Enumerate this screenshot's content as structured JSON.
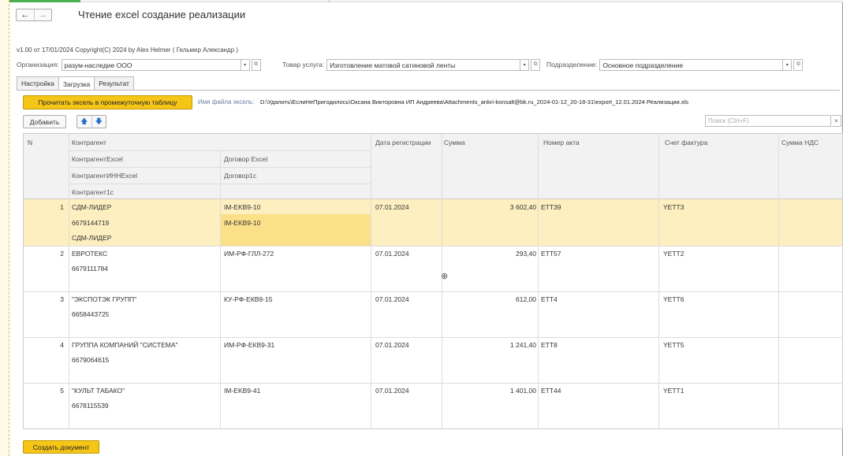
{
  "window": {
    "title": "Чтение excel создание реализации",
    "back": "←",
    "forward": "→"
  },
  "version_line": "v1.00 от 17/01/2024  Copyright(C) 2024 by Alex Helmer ( Гельмер Александр )",
  "fields": {
    "org_label": "Организация:",
    "org_value": "разум-наследие ООО",
    "goods_label": "Товар услуга:",
    "goods_value": "Изготовление матовой сатиновой ленты",
    "dept_label": "Подразделение:",
    "dept_value": "Основное подразделение"
  },
  "tabs": [
    {
      "label": "Настройка"
    },
    {
      "label": "Загрузка"
    },
    {
      "label": "Результат"
    }
  ],
  "toolbar": {
    "read_button": "Прочитать эксель в промежуточную таблицу",
    "filename_label": "Имя файла эксель:",
    "filename_value": "D:\\Удалить\\ЕслиНеПригодилось\\Оксана Викторовна ИП Андреева\\Attachments_ankri-konsalt@bk.ru_2024-01-12_20-18-31\\export_12.01.2024 Реализации.xls",
    "add_button": "Добавить",
    "search_placeholder": "Поиск (Ctrl+F)",
    "search_clear": "×"
  },
  "table": {
    "headers": {
      "n": "N",
      "kontragent": "Контрагент",
      "kontragent_excel": "КонтрагентExcel",
      "dogovor_excel": "Договор Excel",
      "kontragent_inn": "КонтрагентИННExcel",
      "dogovor1c": "Договор1с",
      "kontragent1c": "Контрагент1с",
      "date": "Дата регистрации",
      "sum": "Сумма",
      "act": "Номер акта",
      "invoice": "Счет фактура",
      "vat": "Сумма НДС"
    },
    "rows": [
      {
        "n": "1",
        "name": "СДМ-ЛИДЕР",
        "inn": "6679144719",
        "k1c": "СДМ-ЛИДЕР",
        "contract": "IM-EKB9-10",
        "contract1c": "IM-EKB9-10",
        "date": "07.01.2024",
        "sum": "3 602,40",
        "act": "ETT39",
        "invoice": "YETT3"
      },
      {
        "n": "2",
        "name": "ЕВРОТЕКС",
        "inn": "6679111784",
        "k1c": "",
        "contract": "ИМ-РФ-ГЛЛ-272",
        "contract1c": "",
        "date": "07.01.2024",
        "sum": "293,40",
        "act": "ETT57",
        "invoice": "YETT2"
      },
      {
        "n": "3",
        "name": "\"ЭКСПОТЭК ГРУПП\"",
        "inn": "6658443725",
        "k1c": "",
        "contract": "КУ-РФ-ЕКВ9-15",
        "contract1c": "",
        "date": "07.01.2024",
        "sum": "612,00",
        "act": "ETT4",
        "invoice": "YETT6"
      },
      {
        "n": "4",
        "name": "ГРУППА КОМПАНИЙ \"СИСТЕМА\"",
        "inn": "6679064615",
        "k1c": "",
        "contract": "ИМ-РФ-ЕКВ9-31",
        "contract1c": "",
        "date": "07.01.2024",
        "sum": "1 241,40",
        "act": "ETT8",
        "invoice": "YETT5"
      },
      {
        "n": "5",
        "name": "\"КУЛЬТ ТАБАКО\"",
        "inn": "6678115539",
        "k1c": "",
        "contract": "IM-EKB9-41",
        "contract1c": "",
        "date": "07.01.2024",
        "sum": "1 401,00",
        "act": "ETT44",
        "invoice": "YETT1"
      }
    ]
  },
  "create_button": "Создать документ"
}
